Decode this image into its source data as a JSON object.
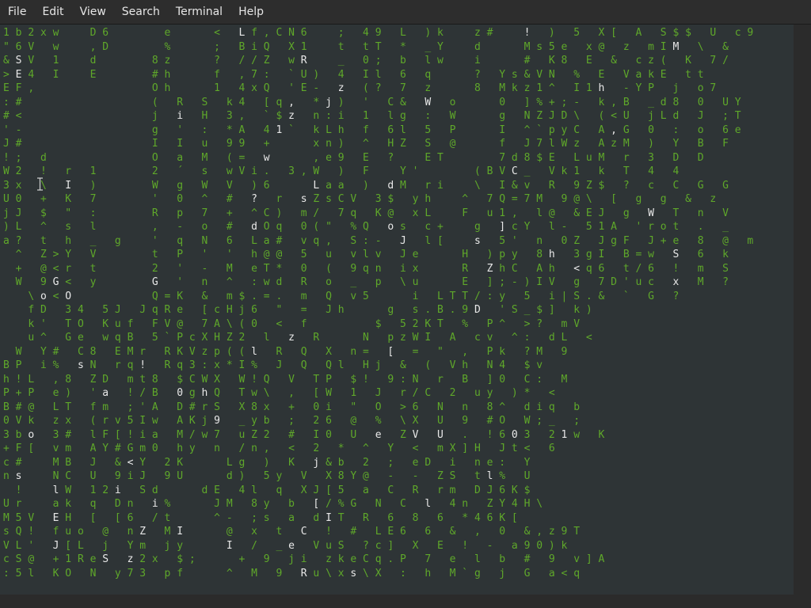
{
  "menubar": {
    "items": [
      "File",
      "Edit",
      "View",
      "Search",
      "Terminal",
      "Help"
    ]
  },
  "terminal": {
    "lines": [
      "1 b 2 x w     D 6         e       <   L f , C N 6     ;   4 9   L   ) k     z #     !   )   5   X [   A   S $ $   U   c 9",
      "\" 6 V   w     , D         %       ;   B i Q   X 1     t   t T   *   _ Y     d       M s 5 e   x @   z   m I M   \\   &",
      "& S V   1     d         8 z       ?   / / Z   w R     _   0 ;   b   l w     i       #   K 8   E   &   c z (   K   7 /",
      "> E 4   I     E         # h       f   , 7 :   ` U )   4   I l   6   q       ?   Y s & V N   %   E   V a k E   t t",
      "E F ,                   O h       1   4 x Q   ' E -   z   ( ?   7   z       8   M k z 1 ^   I 1 h   - Y P   j   o 7",
      ": #                     (   R   S   k 4   [ q ,   * j )   '   C &   W   o       0   ] % + ; -   k , B   _ d 8   0   U Y",
      "# <                     j   i   H   3 ,   ` $ z   n : i   1   l g   :   W       g   N Z J D \\   ( < U   j L d   J   ; T",
      "' -                     g   '   :   * A   4 1 `   k L h   f   6 l   5   P       I   ^ ` p y C   A , G   0   :   o   6 e",
      "J #                     I   I   u   9 9   +       x n )   ^   H Z   S   @       f   J 7 l W z   A z M   )   Y   B   F",
      "! ;   d                 O   a   M   ( =   w       , e 9   E   ?     E T         7 d 8 $ E   L u M   r   3   D   D",
      "W 2   !   r   1         2   ´   s   w V i .   3 , W   )   F     Y '         ( B V C _   V k 1   k   T   4   4",
      "3 x   \\   I   )         W   g   W   V   ) 6       L a a   )   d M   r i     \\   I & v   R   9 Z $   ?   c   C   G   G",
      "U 0   +   K   7         '   0   ^   #   ?   r   s Z s C V   3 $   y h     ^   7 Q = 7 M   9 @ \\   [   g   g   &   z",
      "j J   $   \"   :         R   p   7   +   ^ C )   m /   7 q   K @   x L     F   u 1 ,   l @   & E J   g   W   T   n   V",
      ") L   ^   s   l         ,   -   o   #   d O q   0 ( \"   % Q   o s   c +     g   ] c Y   l -   5 1 A   ' r o t   .   _",
      "a ?   t   h   _   g     '   q   N   6   L a #   v q ,   S : -   J   l [     s   5 '   n   0 Z   J g F   J + e   8   @   m",
      "  ^   Z > Y   V         t   P   '   '   h @ @   5   u   v l v   J e       H   ) p y   8 h   3 g I   B = w   S   6   k",
      "  +   @ < r   t         2   '   -   M   e T *   0   (   9 q n   i x       R   Z h C   A h   < q 6   t / 6   !   m   S",
      "  W   9 G <   y         G   '   n   ^   : w d   R   o   _   p   \\ u       E   ] ; - ) I V   g   7 D ' u c   x   M   ?",
      "    \\ o < O             Q = K   &   m $ . = .   m   Q   v 5       i   L T T / : y   5   i | S . &   `   G   ?",
      "    f D   3 4   5 J   J q R e   [ c H j 6   \"   =   J h       g   s . B . 9 D   ' S _ $ ]   k )",
      "    k '   T O   K u f   F V @   7 A \\ ( 0   <   f           $   5 2 K T   %   P ^   > ?   m V",
      "    u ^   G e   w q B   5 ` P c X H Z 2   l   z   R       N   p z W I   A   c v   ^ :   d L   <",
      "  W   Y #   C 8   E M r   R K V z p ( ( l   R   Q   X   n =   [   =   \"   ,   P k   ? M   9",
      "B P   i %   s N   r q !   R q 3 : x * I %   J   Q   Q l   H j   &   (   V h   N 4   $ v",
      "h ! L   , 8   Z D   m t 8   $ C W X   W ! Q   V   T P   $ !   9 : N   r   B   ] 0   C :   M",
      "P + P   e )   ' a   ! / B   0 g h Q   T w \\   ,   [ W   1   J   r / C   2   u y   ) *   <",
      "B # @   L T   f m   ; ' A   D # r S   X 8 x   +   0 i   \"   O   > 6   N   n   8 ^   d i q   b",
      "0 V k   z x   ( r v 5 I w   A K j 9   _ y b   ;   2 6   @   %   \\ X   U   9   # O   W ; _   ;",
      "3 b o   3 #   l F [ ! i a   M / w 7   u Z 2   #   I 0   U   e   Z V   U   .   ! 6 0 3   2 1 w   K",
      "+ F [   v m   A Y # G m 0   h y   n   / n ,   <   2   *   ^   Y   <   m X ] H   J t <   6",
      "c #     M B   J   & < Y   2 K       L g   )   K   j & b   2   ;   e D   i   n e :   Y",
      "n s     N C   U   9 i J   9 U       d )   5 y   V   X 8 Y @   -   -   Z S   t l %   U",
      "  !     l W   1 2 i   S d       d E   4 l   q   X J [ 5   a   C   R   r m   D J 6 K $",
      "U r     a k   q   D n   i %       J M   8 y   b   [ / % G   N   C   l   4 n   Z Y 4 H \\",
      "M 5 V   E H   [   [ 6   / t       ^ -   ; s   a   d I T   R   6   8   6   * 4 6 K [",
      "s Q !   f u o   @   n Z   M I       @   x   t   C   !   #   L E 6   6   &   ,   0   & , z 9 T",
      "V L '   J [ L   j   Y m   j y       I   /   _ e   V u S   ? c ]   X   E   !   -   a 9 0 ) k",
      "c S @   + 1 R e S   z 2 x   $ ;       +   9   j i   z k e C q . P   7   e   l   b   #   9   v ] A",
      ": 5 l   K O   N   y 7 3   p f       ^   M   9   R u \\ x s \\ X   :   h   M ` g   j   G   a < q"
    ]
  }
}
